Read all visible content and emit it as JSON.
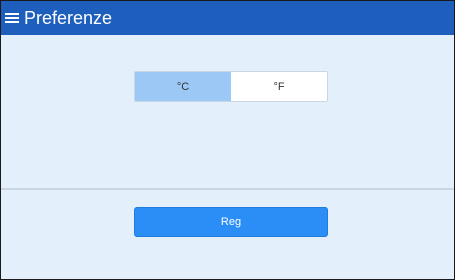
{
  "header": {
    "title": "Preferenze",
    "menu_icon": "hamburger-menu-icon",
    "background_color": "#1e5fbe"
  },
  "temperature_unit": {
    "options": [
      {
        "label": "°C",
        "selected": true
      },
      {
        "label": "°F",
        "selected": false
      }
    ],
    "selected_color": "#9cc8f6"
  },
  "actions": {
    "save_label": "Reg",
    "button_color": "#2b8ef6"
  },
  "colors": {
    "page_background": "#e3effa"
  }
}
